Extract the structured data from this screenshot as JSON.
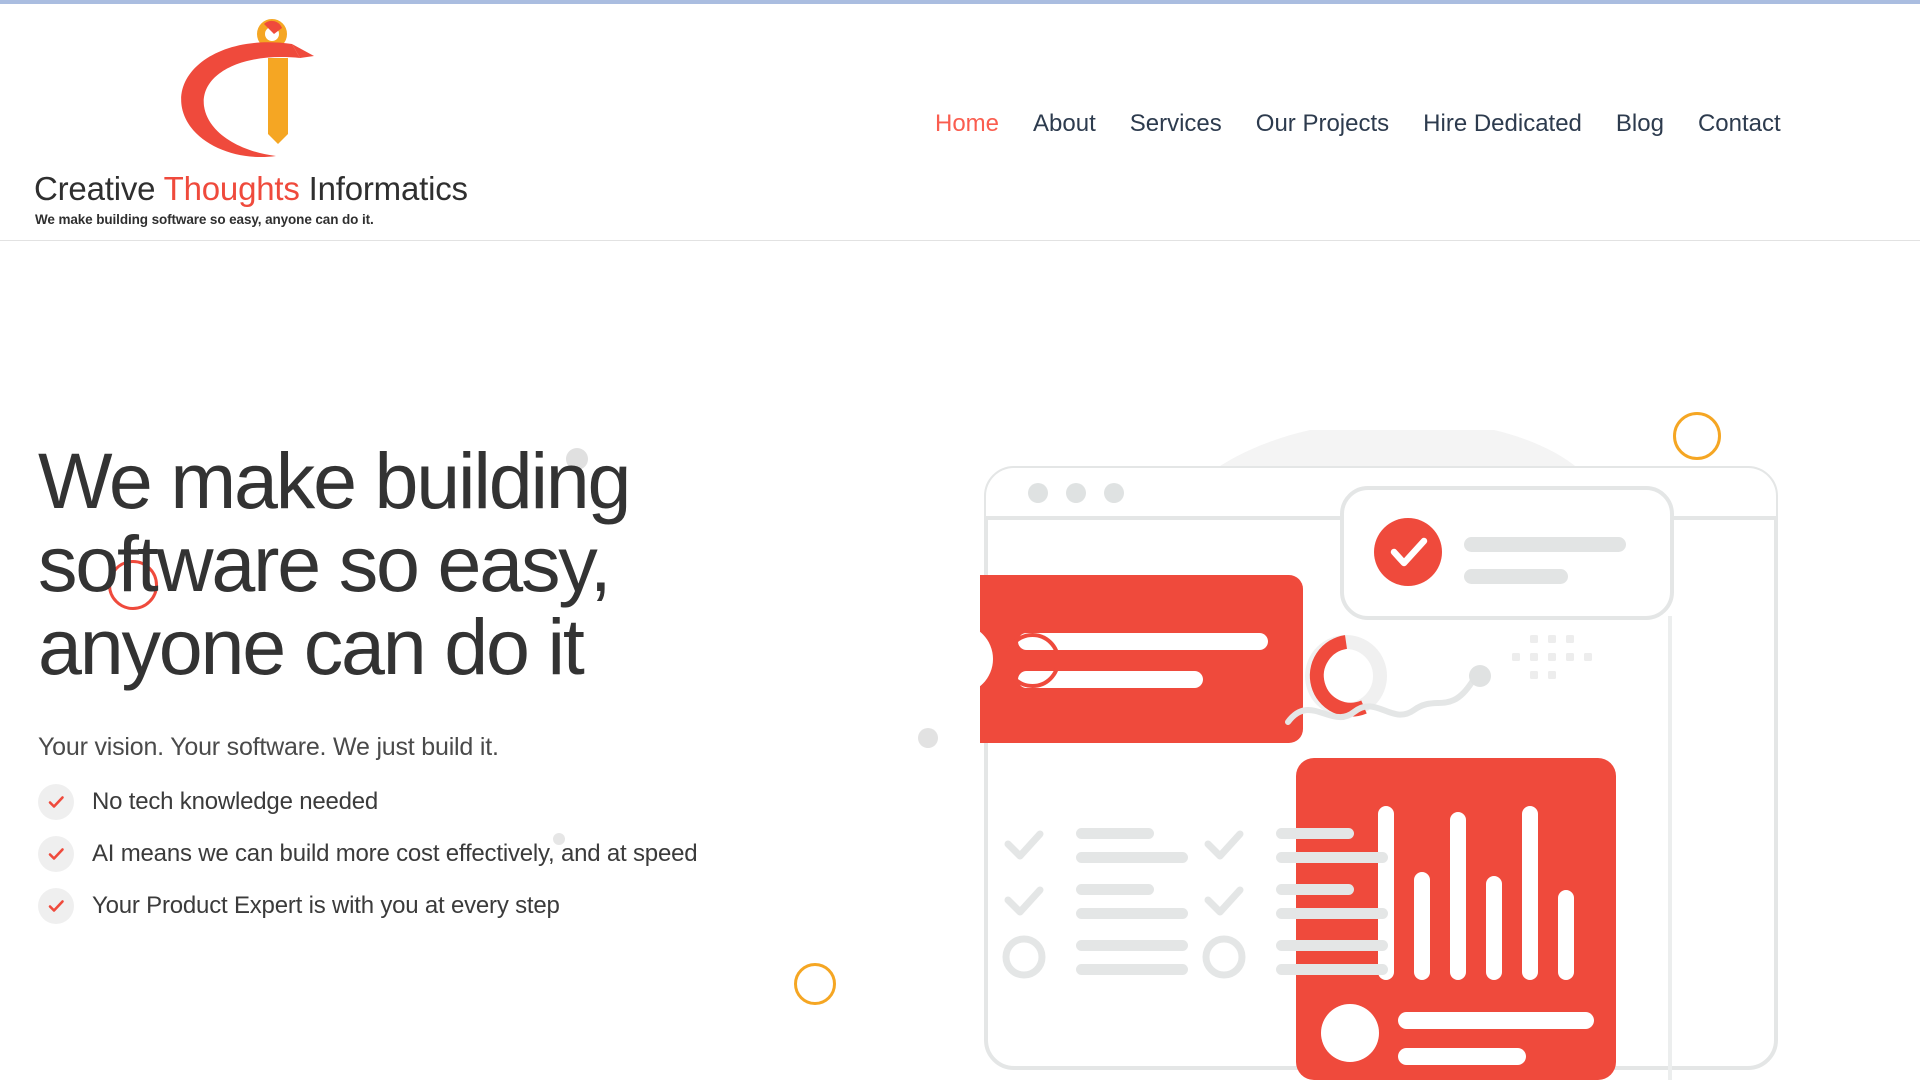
{
  "brand": {
    "name_part1": "Creative",
    "name_highlight": "Thoughts",
    "name_part2": "Informatics",
    "tagline": "We make building software so easy, anyone can do it.",
    "logo_icon": "ci-monogram-logo",
    "accent_red": "#EF4A3C",
    "accent_orange": "#F5A623"
  },
  "nav": {
    "items": [
      {
        "label": "Home",
        "active": true
      },
      {
        "label": "About",
        "active": false
      },
      {
        "label": "Services",
        "active": false
      },
      {
        "label": "Our Projects",
        "active": false
      },
      {
        "label": "Hire Dedicated",
        "active": false
      },
      {
        "label": "Blog",
        "active": false
      },
      {
        "label": "Contact",
        "active": false
      }
    ]
  },
  "hero": {
    "heading_line1": "We make building",
    "heading_line2": "software so easy,",
    "heading_line3": "anyone can do it",
    "subheading": "Your vision. Your software. We just build it.",
    "features": [
      {
        "icon": "check-icon",
        "label": "No tech knowledge needed"
      },
      {
        "icon": "check-icon",
        "label": "AI means we can build more cost effectively, and at speed"
      },
      {
        "icon": "check-icon",
        "label": "Your Product Expert is with you at every step"
      }
    ]
  },
  "illustration": {
    "name": "dashboard-illustration",
    "browser_window": {
      "dots": 3
    },
    "red_notification_card": {
      "lines": 2,
      "avatar": "circle-avatar"
    },
    "approved_card": {
      "icon": "check-circle-icon",
      "lines": 2
    },
    "donut_chart": {
      "icon": "donut-progress-icon"
    },
    "bar_chart_card": {
      "icon": "bar-chart-icon",
      "bars": [
        100,
        62,
        98,
        60,
        100,
        50
      ],
      "lines": 2,
      "avatar": "circle-avatar"
    },
    "checklist": {
      "columns": 2,
      "rows_per_column": [
        {
          "icon": "check-icon"
        },
        {
          "icon": "check-icon"
        },
        {
          "icon": "circle-outline-icon"
        }
      ]
    },
    "squiggle_line": {
      "icon": "wavy-line-icon",
      "endpoint_dot": true
    },
    "dot_grids": 2
  },
  "decorations": {
    "shapes": [
      {
        "name": "ring-red-hero",
        "color": "#EF4A3C",
        "type": "ring"
      },
      {
        "name": "ring-orange-top",
        "color": "#F5A623",
        "type": "ring"
      },
      {
        "name": "ring-orange-bottom",
        "color": "#F5A623",
        "type": "ring"
      },
      {
        "name": "dot-red",
        "color": "#EF4A3C",
        "type": "dot"
      },
      {
        "name": "dot-gray-large",
        "color": "#E0E0E0",
        "type": "dot"
      },
      {
        "name": "dot-gray-medium",
        "color": "#E2E2E2",
        "type": "dot"
      },
      {
        "name": "dot-gray-small",
        "color": "#E6E6E6",
        "type": "dot"
      }
    ]
  }
}
